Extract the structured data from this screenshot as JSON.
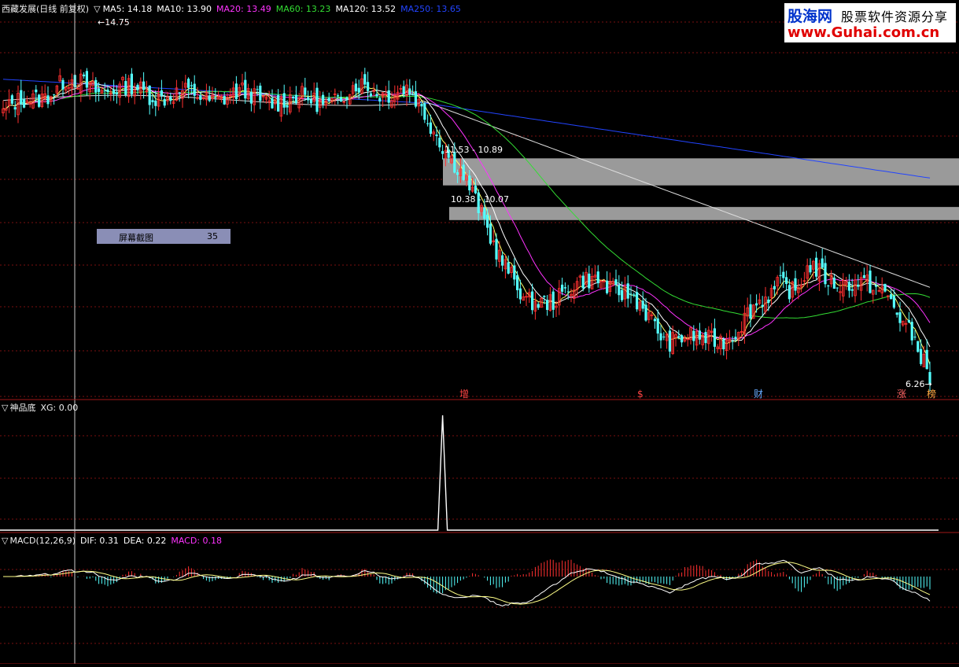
{
  "main_panel": {
    "stock_title": "西藏发展(日线 前复权)",
    "ma_legend": [
      {
        "label": "MA5: 14.18",
        "color": "#ffffff"
      },
      {
        "label": "MA10: 13.90",
        "color": "#ffffff"
      },
      {
        "label": "MA20: 13.49",
        "color": "#ff33ff"
      },
      {
        "label": "MA60: 13.23",
        "color": "#33dd33"
      },
      {
        "label": "MA120: 13.52",
        "color": "#ffffff"
      },
      {
        "label": "MA250: 13.65",
        "color": "#2244ff"
      }
    ],
    "high_label": "14.75",
    "low_label": "6.26",
    "gap_labels": [
      "11.53 - 10.89",
      "10.38 - 10.07"
    ],
    "markers": [
      {
        "text": "增",
        "color": "#ff4444"
      },
      {
        "text": "$",
        "color": "#ff4444"
      },
      {
        "text": "财",
        "color": "#66aaff"
      },
      {
        "text": "涨",
        "color": "#ff6666"
      },
      {
        "text": "榜",
        "color": "#ffaa44"
      }
    ],
    "screenshot_badge": {
      "label": "屏幕截图",
      "value": "35"
    }
  },
  "indicator_panel": {
    "title": "神品底",
    "legend": "XG: 0.00"
  },
  "macd_panel": {
    "title": "MACD(12,26,9)",
    "legend": [
      {
        "label": "DIF: 0.31",
        "color": "#ffffff"
      },
      {
        "label": "DEA: 0.22",
        "color": "#ffffff"
      },
      {
        "label": "MACD: 0.18",
        "color": "#ff33ff"
      }
    ]
  },
  "watermark": {
    "site_name": "股海网",
    "slogan": "股票软件资源分享",
    "url": "www.Guhai.com.cn"
  },
  "colors": {
    "up": "#ff3030",
    "down": "#54ffff",
    "grid": "#7a1010",
    "separator": "#a01818"
  },
  "chart_data": [
    {
      "type": "candlestick",
      "title": "西藏发展(日线 前复权)",
      "ylim": [
        5.9,
        15.2
      ],
      "price_anchors": {
        "x": [
          0,
          20,
          60,
          80,
          95,
          110,
          120,
          135,
          145,
          160,
          175,
          185,
          200,
          210,
          222,
          232,
          245,
          260,
          265,
          270,
          285,
          296,
          305,
          310
        ],
        "close": [
          12.6,
          13.3,
          13.0,
          13.0,
          12.9,
          12.9,
          13.2,
          13.1,
          12.2,
          10.2,
          8.0,
          8.3,
          8.7,
          8.2,
          7.3,
          7.2,
          7.4,
          8.7,
          8.3,
          8.9,
          8.5,
          8.4,
          7.1,
          6.26
        ]
      },
      "moving_averages": [
        "MA5",
        "MA10",
        "MA20",
        "MA60",
        "MA120",
        "MA250"
      ],
      "gaps": [
        [
          11.53,
          10.89
        ],
        [
          10.38,
          10.07
        ]
      ]
    },
    {
      "type": "line",
      "title": "神品底",
      "series": [
        {
          "name": "XG",
          "signal_at": 150
        }
      ],
      "ylim": [
        0,
        1
      ]
    },
    {
      "type": "bar",
      "title": "MACD(12,26,9)",
      "ylim": [
        -1.55,
        0.4
      ],
      "series": [
        {
          "name": "DIF"
        },
        {
          "name": "DEA"
        },
        {
          "name": "MACD"
        }
      ]
    }
  ]
}
